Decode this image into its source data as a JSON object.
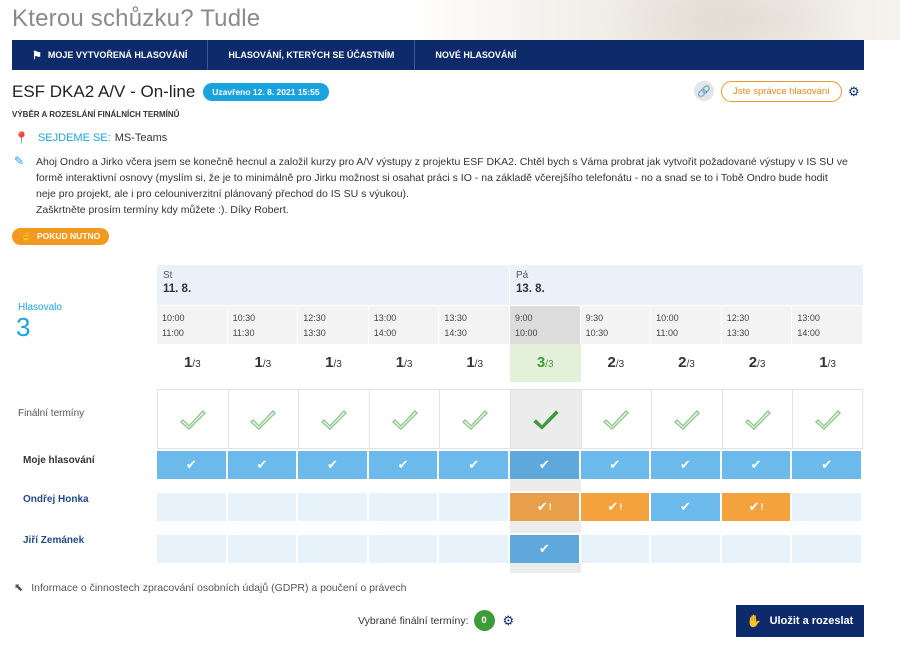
{
  "app": {
    "brand": "Kterou schůzku? Tudle"
  },
  "nav": {
    "items": [
      {
        "label": "Moje vytvořená hlasování",
        "icon": "signpost-icon"
      },
      {
        "label": "Hlasování, kterých se účastním"
      },
      {
        "label": "Nové hlasování"
      }
    ],
    "background": "#0d2b6b"
  },
  "poll": {
    "title": "ESF DKA2 A/V - On-line",
    "closed_badge": "Uzavřeno 12. 8. 2021 15:55",
    "subtitle": "Výběr a rozeslání finálních termínů",
    "admin_label": "Jste správce hlasování",
    "meet_label": "SEJDEME SE:",
    "meet_value": "MS-Teams",
    "description_lines": [
      "Ahoj Ondro a Jirko včera jsem se konečně hecnul a založil kurzy pro A/V výstupy z projektu ESF DKA2. Chtěl bych s Váma probrat jak vytvořit požadované výstupy v IS SU ve",
      "formě interaktivní osnovy (myslím si, že je to minimálně pro Jirku možnost si osahat práci s IO - na základě včerejšího telefonátu - no a snad se to i Tobě Ondro bude hodit",
      "neje pro projekt, ale i pro celouniverzitní plánovaný přechod do IS SU s výukou).",
      "Zaškrtněte prosím termíny kdy můžete :). Díky Robert."
    ],
    "if_needed_label": "Pokud nutno",
    "accent_color": "#1ba3e0"
  },
  "voting": {
    "voted_label": "Hlasovalo",
    "voted_count": "3",
    "days": [
      {
        "name": "St",
        "date": "11. 8.",
        "span": 5
      },
      {
        "name": "Pá",
        "date": "13. 8.",
        "span": 5
      }
    ],
    "slots": [
      {
        "start": "10:00",
        "end": "11:00",
        "yes": "1",
        "total": "/3"
      },
      {
        "start": "10:30",
        "end": "11:30",
        "yes": "1",
        "total": "/3"
      },
      {
        "start": "12:30",
        "end": "13:30",
        "yes": "1",
        "total": "/3"
      },
      {
        "start": "13:00",
        "end": "14:00",
        "yes": "1",
        "total": "/3"
      },
      {
        "start": "13:30",
        "end": "14:30",
        "yes": "1",
        "total": "/3"
      },
      {
        "start": "9:00",
        "end": "10:00",
        "yes": "3",
        "total": "/3",
        "highlight": true
      },
      {
        "start": "9:30",
        "end": "10:30",
        "yes": "2",
        "total": "/3"
      },
      {
        "start": "10:00",
        "end": "11:00",
        "yes": "2",
        "total": "/3"
      },
      {
        "start": "12:30",
        "end": "13:30",
        "yes": "2",
        "total": "/3"
      },
      {
        "start": "13:00",
        "end": "14:00",
        "yes": "1",
        "total": "/3"
      }
    ],
    "final_label": "Finální termíny",
    "final_selected_index": 5,
    "rows": [
      {
        "label": "Moje hlasování",
        "kind": "me",
        "cells": [
          "yes",
          "yes",
          "yes",
          "yes",
          "yes",
          "yes",
          "yes",
          "yes",
          "yes",
          "yes"
        ]
      },
      {
        "label": "Ondřej Honka",
        "kind": "person",
        "cells": [
          "none",
          "none",
          "none",
          "none",
          "none",
          "maybe",
          "maybe",
          "yes",
          "maybe",
          "none"
        ]
      },
      {
        "label": "Jiří Zemánek",
        "kind": "person",
        "cells": [
          "none",
          "none",
          "none",
          "none",
          "none",
          "yes",
          "none",
          "none",
          "none",
          "none"
        ]
      }
    ],
    "colors": {
      "yes": "#6cb9ec",
      "maybe": "#f3a23d",
      "none": "#e8f2fb",
      "final": "#3e9b3a"
    }
  },
  "footer": {
    "gdpr_text": "Informace o činnostech zpracování osobních údajů (GDPR) a poučení o právech",
    "selected_label": "Vybrané finální termíny:",
    "selected_count": "0",
    "save_label": "Uložit a rozeslat"
  }
}
